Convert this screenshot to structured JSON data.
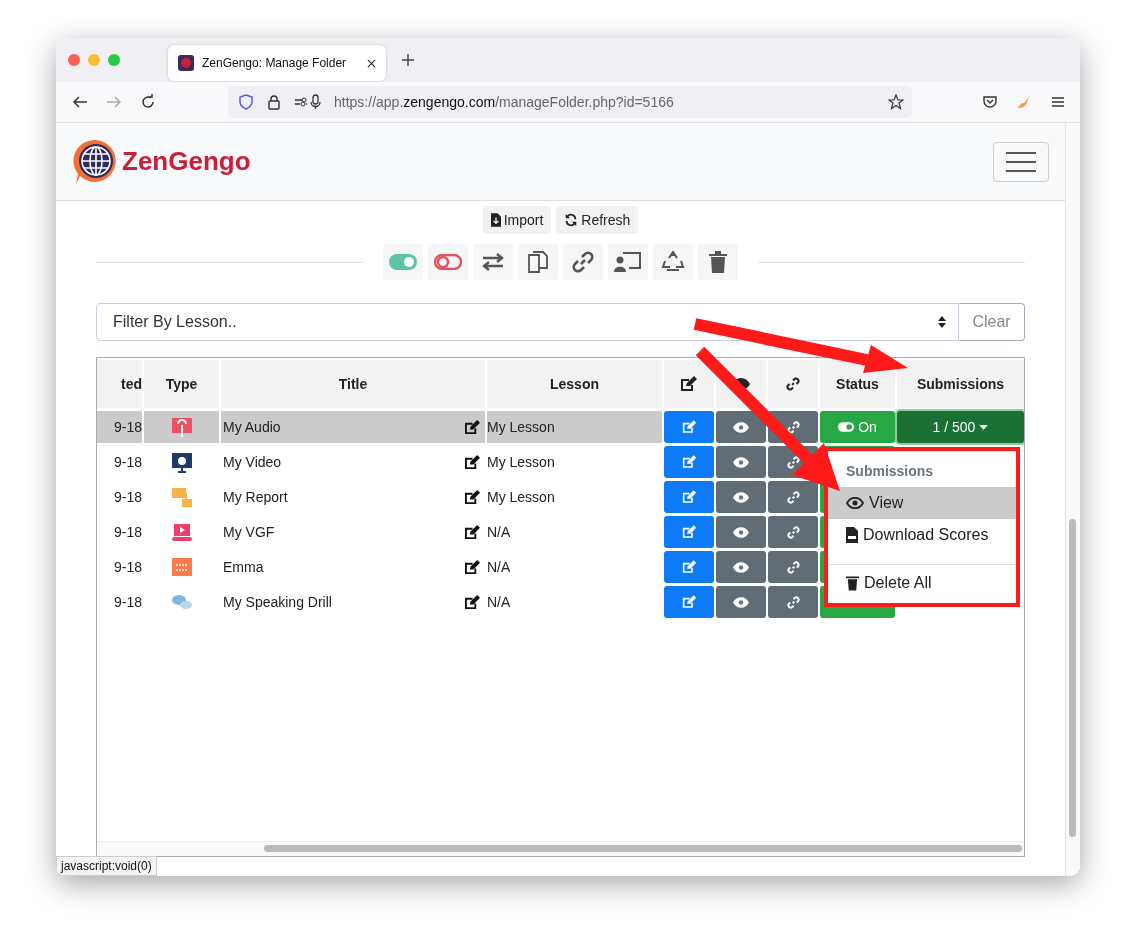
{
  "browser": {
    "tab_title": "ZenGengo: Manage Folder",
    "url_prefix": "https://app.",
    "url_domain": "zengengo.com",
    "url_path": "/manageFolder.php?id=5166",
    "status_text": "javascript:void(0)"
  },
  "header": {
    "logo_text": "ZenGengo"
  },
  "actions": [
    "Import",
    "Refresh"
  ],
  "filter": {
    "placeholder": "Filter By Lesson..",
    "clear_label": "Clear"
  },
  "table": {
    "columns": [
      "ted",
      "Type",
      "Title",
      "Lesson",
      "Status",
      "Submissions"
    ],
    "rows": [
      {
        "date": "9-18",
        "kind": "audio",
        "title": "My Audio",
        "lesson": "My Lesson",
        "selected": true,
        "status": "On",
        "submissions": "1 / 500"
      },
      {
        "date": "9-18",
        "kind": "video",
        "title": "My Video",
        "lesson": "My Lesson",
        "selected": false
      },
      {
        "date": "9-18",
        "kind": "report",
        "title": "My Report",
        "lesson": "My Lesson",
        "selected": false
      },
      {
        "date": "9-18",
        "kind": "vgf",
        "title": "My VGF",
        "lesson": "N/A",
        "selected": false
      },
      {
        "date": "9-18",
        "kind": "quiz",
        "title": "Emma",
        "lesson": "N/A",
        "selected": false
      },
      {
        "date": "9-18",
        "kind": "speaking",
        "title": "My Speaking Drill",
        "lesson": "N/A",
        "selected": false
      }
    ]
  },
  "dropdown": {
    "header": "Submissions",
    "groups": [
      [
        {
          "kind": "eye",
          "label": "View",
          "selected": true
        },
        {
          "kind": "file",
          "label": "Download Scores",
          "selected": false
        }
      ],
      [
        {
          "kind": "trash",
          "label": "Delete All",
          "selected": false
        }
      ]
    ]
  }
}
